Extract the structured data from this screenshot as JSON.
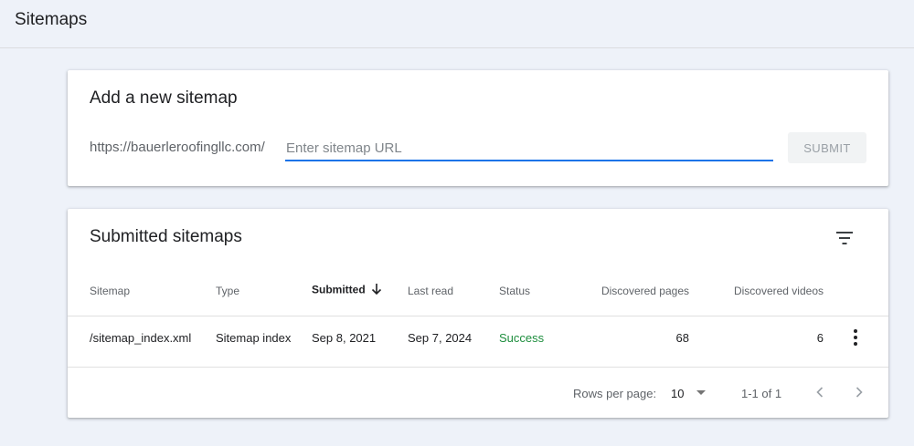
{
  "page": {
    "title": "Sitemaps"
  },
  "add_sitemap": {
    "title": "Add a new sitemap",
    "url_prefix": "https://bauerleroofingllc.com/",
    "input_value": "",
    "input_placeholder": "Enter sitemap URL",
    "submit_label": "SUBMIT"
  },
  "submitted": {
    "title": "Submitted sitemaps",
    "columns": {
      "sitemap": "Sitemap",
      "type": "Type",
      "submitted": "Submitted",
      "last_read": "Last read",
      "status": "Status",
      "discovered_pages": "Discovered pages",
      "discovered_videos": "Discovered videos"
    },
    "sorted_column": "submitted",
    "rows": [
      {
        "sitemap": "/sitemap_index.xml",
        "type": "Sitemap index",
        "submitted": "Sep 8, 2021",
        "last_read": "Sep 7, 2024",
        "status": "Success",
        "discovered_pages": "68",
        "discovered_videos": "6"
      }
    ],
    "pagination": {
      "rows_per_page_label": "Rows per page:",
      "rows_per_page_value": "10",
      "range": "1-1 of 1"
    }
  },
  "icons": {
    "filter": "filter-icon",
    "sort": "arrow-down-icon",
    "more": "more-vert-icon",
    "prev": "chevron-left-icon",
    "next": "chevron-right-icon"
  },
  "colors": {
    "accent": "#1a73e8",
    "success": "#1e8e3e",
    "background": "#eef2f9"
  }
}
